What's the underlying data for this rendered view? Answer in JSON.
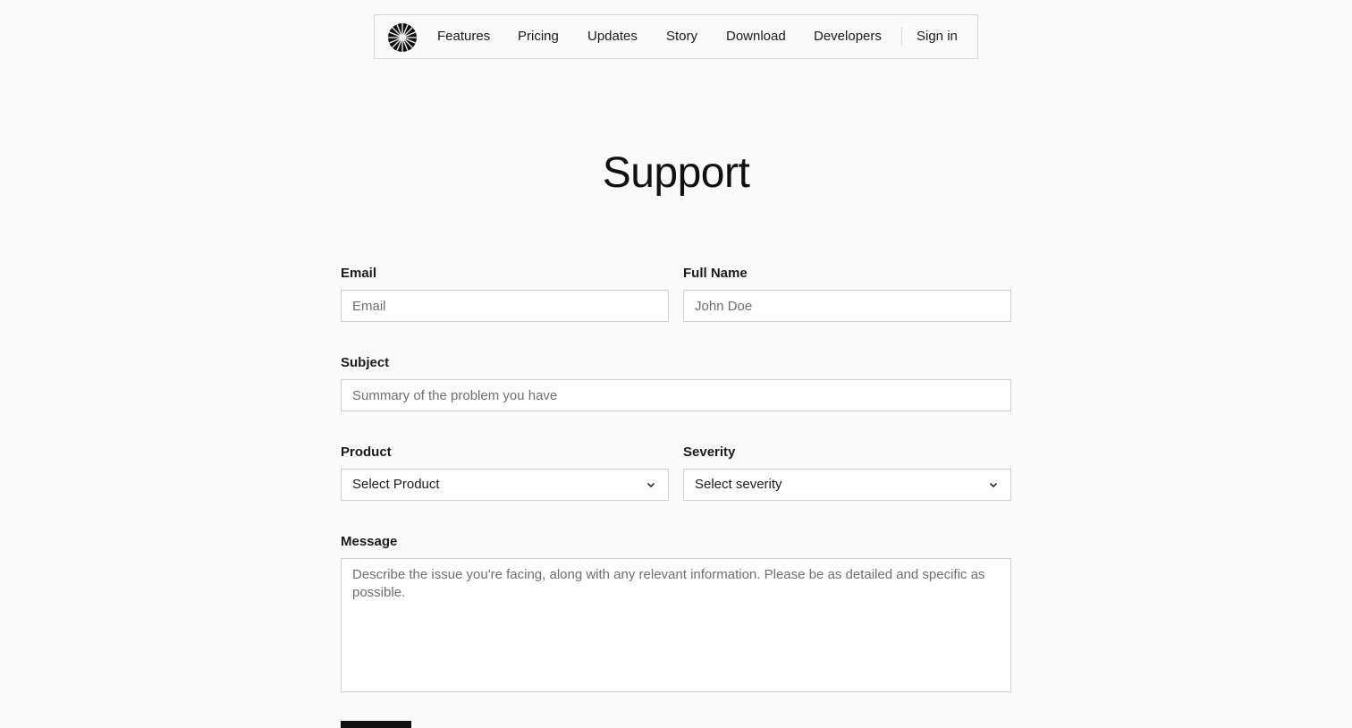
{
  "nav": {
    "logo_icon": "sunburst-logo-icon",
    "links": [
      {
        "label": "Features"
      },
      {
        "label": "Pricing"
      },
      {
        "label": "Updates"
      },
      {
        "label": "Story"
      },
      {
        "label": "Download"
      },
      {
        "label": "Developers"
      }
    ],
    "sign_in": "Sign in"
  },
  "page": {
    "title": "Support"
  },
  "form": {
    "email": {
      "label": "Email",
      "placeholder": "Email",
      "value": ""
    },
    "full_name": {
      "label": "Full Name",
      "placeholder": "John Doe",
      "value": ""
    },
    "subject": {
      "label": "Subject",
      "placeholder": "Summary of the problem you have",
      "value": ""
    },
    "product": {
      "label": "Product",
      "selected": "Select Product"
    },
    "severity": {
      "label": "Severity",
      "selected": "Select severity"
    },
    "message": {
      "label": "Message",
      "placeholder": "Describe the issue you're facing, along with any relevant information. Please be as detailed and specific as possible.",
      "value": ""
    },
    "submit_label": ""
  },
  "colors": {
    "background": "#fafafa",
    "border": "#cfcfcf",
    "text": "#111111",
    "button": "#111111"
  }
}
